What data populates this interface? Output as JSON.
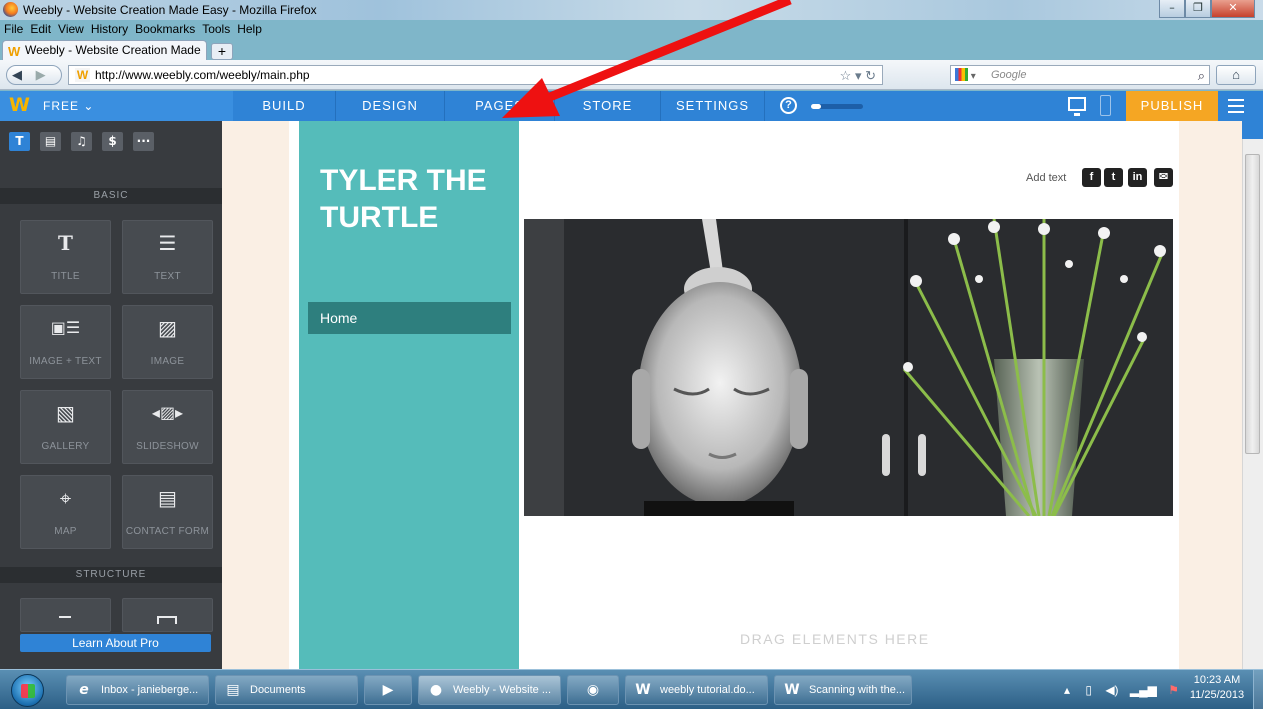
{
  "window": {
    "title": "Weebly - Website Creation Made Easy - Mozilla Firefox",
    "minimize": "–",
    "restore": "❐",
    "close": "✕"
  },
  "menu": [
    "File",
    "Edit",
    "View",
    "History",
    "Bookmarks",
    "Tools",
    "Help"
  ],
  "tab": {
    "label": "Weebly - Website Creation Made Easy",
    "new_tab": "+"
  },
  "nav": {
    "url": "http://www.weebly.com/weebly/main.php",
    "search_placeholder": "Google",
    "back": "◀",
    "forward": "▶",
    "home": "⌂"
  },
  "weebly": {
    "plan": "FREE ⌄",
    "nav_items": [
      "BUILD",
      "DESIGN",
      "PAGES",
      "STORE",
      "SETTINGS"
    ],
    "help": "?",
    "progress": 0.2,
    "publish": "PUBLISH"
  },
  "panel": {
    "categories": [
      "T",
      "▤",
      "♫",
      "$",
      "···"
    ],
    "basic_label": "BASIC",
    "structure_label": "STRUCTURE",
    "tiles": [
      {
        "label": "TITLE",
        "icon": "T"
      },
      {
        "label": "TEXT",
        "icon": "☰"
      },
      {
        "label": "IMAGE + TEXT",
        "icon": "▣☰"
      },
      {
        "label": "IMAGE",
        "icon": "▨"
      },
      {
        "label": "GALLERY",
        "icon": "▧"
      },
      {
        "label": "SLIDESHOW",
        "icon": "◂▨▸"
      },
      {
        "label": "MAP",
        "icon": "⌖"
      },
      {
        "label": "CONTACT FORM",
        "icon": "▤"
      }
    ],
    "learn_pro": "Learn About Pro"
  },
  "site": {
    "title": "TYLER THE TURTLE",
    "nav_home": "Home",
    "add_text": "Add text",
    "social": [
      "f",
      "t",
      "in",
      "✉"
    ],
    "drag_here": "DRAG ELEMENTS HERE"
  },
  "taskbar": {
    "items": [
      {
        "label": "Inbox - janieberge...",
        "icon": "e",
        "color": "#2a82d0"
      },
      {
        "label": "Documents",
        "icon": "▤",
        "color": "#6c8fb0"
      },
      {
        "label": "",
        "icon": "▶",
        "color": "#e8622c"
      },
      {
        "label": "Weebly - Website ...",
        "icon": "●",
        "color": "#ef7a22"
      },
      {
        "label": "",
        "icon": "◉",
        "color": "#38a048"
      },
      {
        "label": "weebly tutorial.do...",
        "icon": "W",
        "color": "#2b5797"
      },
      {
        "label": "Scanning with the...",
        "icon": "W",
        "color": "#2b5797"
      }
    ],
    "time": "10:23 AM",
    "date": "11/25/2013"
  }
}
